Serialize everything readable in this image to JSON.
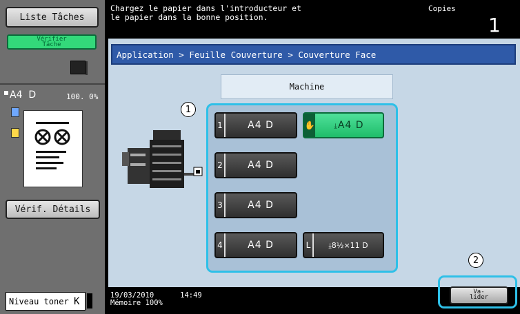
{
  "left_panel": {
    "jobs_button": "Liste Tâches",
    "verify_job_button": "Vérifier\nTâche",
    "paper_size": "A4",
    "paper_orientation": "D",
    "zoom": "100. 0%",
    "details_button": "Vérif. Détails",
    "toner_label": "Niveau toner",
    "toner_unit": "K"
  },
  "header": {
    "message": "Chargez le papier dans l'introducteur et\nle papier dans la bonne position.",
    "copies_label": "Copies",
    "copies_count": "1"
  },
  "main": {
    "breadcrumb": "Application > Feuille Couverture  > Couverture Face",
    "source_label": "Machine",
    "trays": [
      {
        "num": "1",
        "label": "A4 D"
      },
      {
        "num": "",
        "label": "A4 D"
      },
      {
        "num": "2",
        "label": "A4 D"
      },
      {
        "num": "3",
        "label": "A4 D"
      },
      {
        "num": "4",
        "label": "A4 D"
      },
      {
        "num": "L",
        "label": "8½×11 D"
      }
    ]
  },
  "callouts": [
    "1",
    "2"
  ],
  "footer": {
    "datetime": "19/03/2010      14:49",
    "memory": "Mémoire          100%",
    "ok_button": "Va-\nlider"
  },
  "colors": {
    "breadcrumb_blue": "#2f5aa8",
    "selection_green": "#33d97a",
    "highlight_cyan": "#2ec0e8"
  }
}
